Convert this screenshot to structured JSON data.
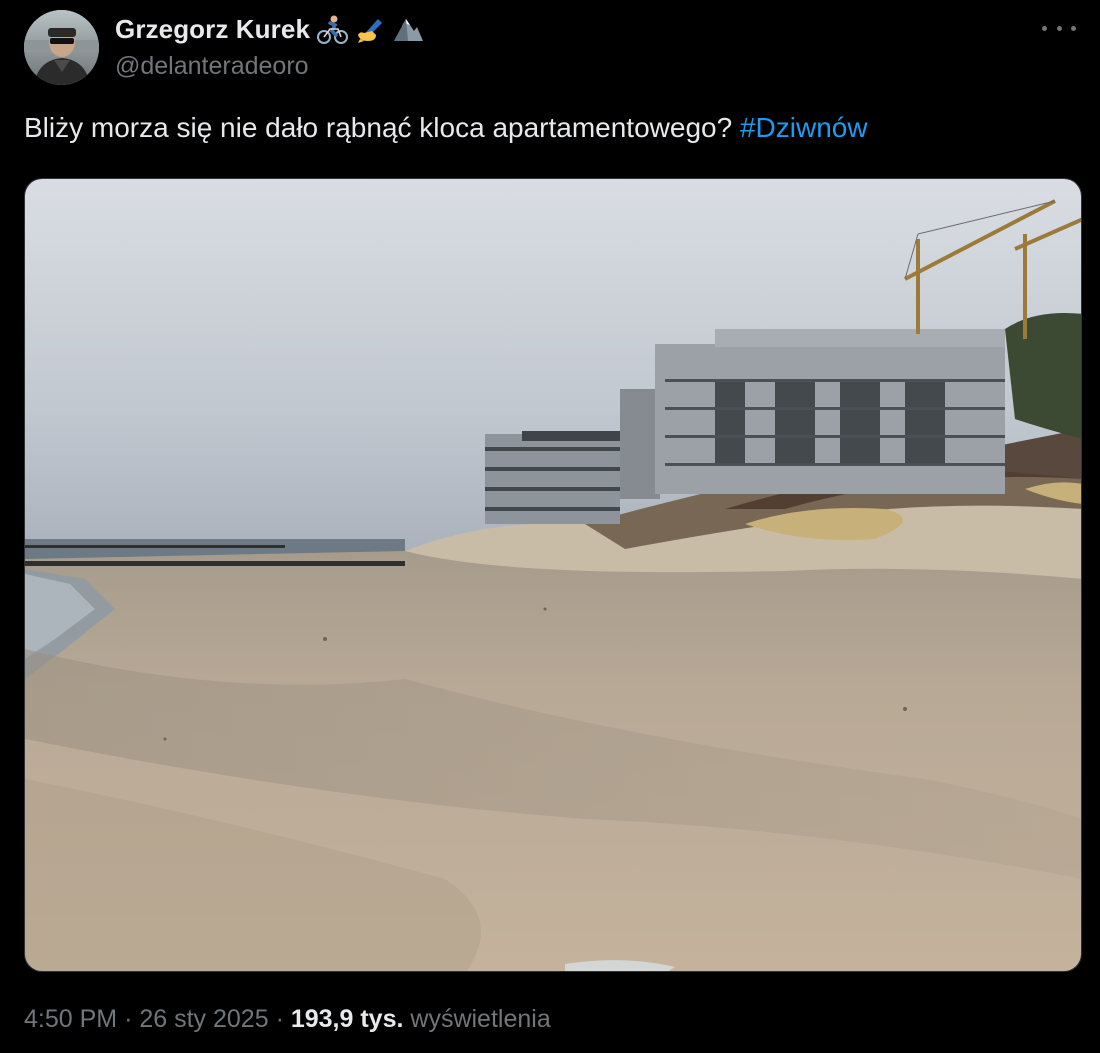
{
  "author": {
    "display_name": "Grzegorz Kurek",
    "handle": "@delanteradeoro",
    "emojis": [
      "cyclist-emoji",
      "writing-hand-emoji",
      "mountain-emoji"
    ]
  },
  "tweet": {
    "text": "Bliży morza się nie dało rąbnąć kloca apartamentowego?",
    "hashtag": "#Dziwnów"
  },
  "footer": {
    "time": "4:50 PM",
    "separator": "·",
    "date": "26 sty 2025",
    "views_count": "193,9 tys.",
    "views_label": "wyświetlenia"
  },
  "colors": {
    "background": "#000000",
    "text": "#e7e9ea",
    "secondary": "#71767b",
    "link": "#1d9bf0"
  }
}
